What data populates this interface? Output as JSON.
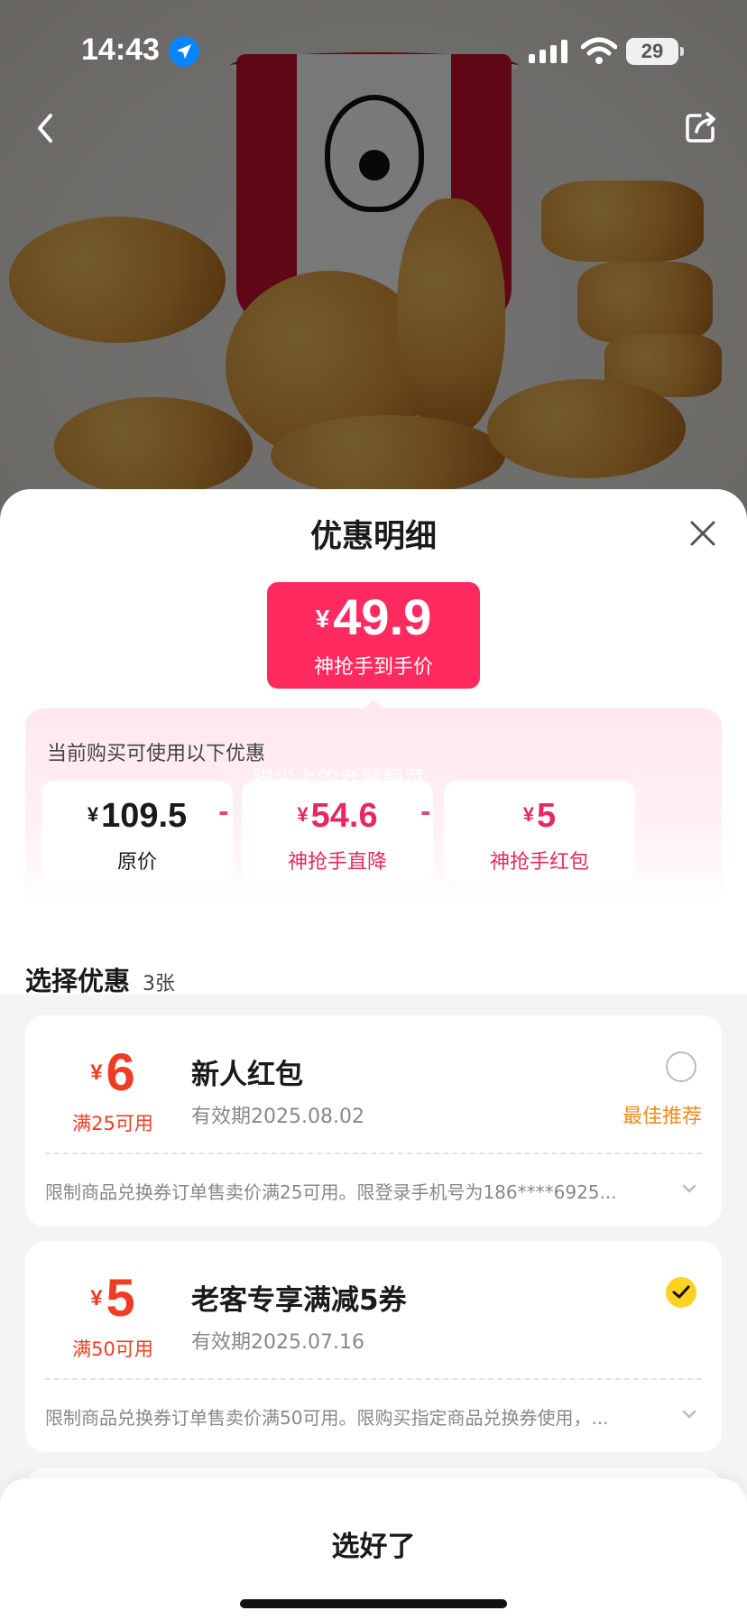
{
  "status_bar": {
    "time": "14:43",
    "battery": "29"
  },
  "sheet": {
    "title": "优惠明细"
  },
  "final_price": {
    "currency": "¥",
    "value": "49.9",
    "label": "神抢手到手价"
  },
  "promo": {
    "caption": "当前购买可使用以下优惠",
    "watermark": "脚尖上的老饕靓菜",
    "items": [
      {
        "currency": "¥",
        "value": "109.5",
        "label": "原价"
      },
      {
        "currency": "¥",
        "value": "54.6",
        "label": "神抢手直降"
      },
      {
        "currency": "¥",
        "value": "5",
        "label": "神抢手红包"
      }
    ],
    "operators": [
      "-",
      "-"
    ]
  },
  "select": {
    "title": "选择优惠",
    "count": "3张"
  },
  "coupons": [
    {
      "currency": "¥",
      "amount": "6",
      "condition": "满25可用",
      "name": "新人红包",
      "validity": "有效期2025.08.02",
      "tag": "最佳推荐",
      "selected": false,
      "description": "限制商品兑换券订单售卖价满25可用。限登录手机号为186****6925..."
    },
    {
      "currency": "¥",
      "amount": "5",
      "condition": "满50可用",
      "name": "老客专享满减5券",
      "validity": "有效期2025.07.16",
      "tag": "",
      "selected": true,
      "description": "限制商品兑换券订单售卖价满50可用。限购买指定商品兑换券使用，..."
    }
  ],
  "footer": {
    "done_label": "选好了"
  },
  "colors": {
    "accent": "#ff2a5f",
    "coupon_red": "#ef3d23",
    "best_orange": "#f08a1c",
    "check_yellow": "#ffd21f"
  }
}
